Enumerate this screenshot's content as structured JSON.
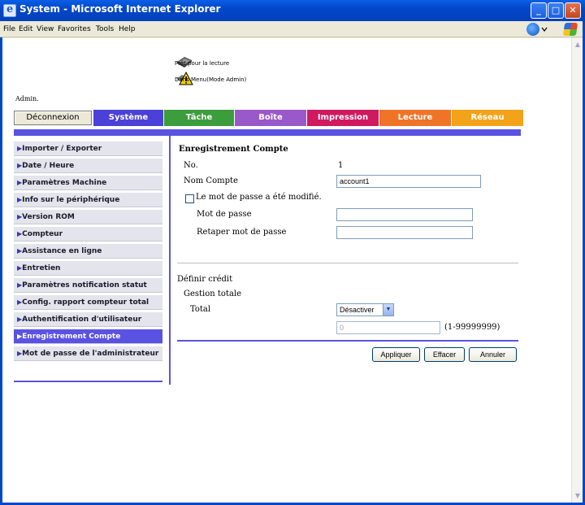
{
  "window": {
    "title": "System - Microsoft Internet Explorer",
    "min": "_",
    "max": "□",
    "close": "✕"
  },
  "menubar": {
    "items": [
      {
        "label": "File",
        "key": "F"
      },
      {
        "label": "Edit",
        "key": "E"
      },
      {
        "label": "View",
        "key": "V"
      },
      {
        "label": "Favorites",
        "key": "a"
      },
      {
        "label": "Tools",
        "key": "T"
      },
      {
        "label": "Help",
        "key": "H"
      }
    ]
  },
  "status": {
    "line1": "Prêt pour la lecture",
    "line2": "Dans Menu(Mode Admin)"
  },
  "admin_label": "Admin.",
  "nav": {
    "logout": "Déconnexion",
    "tabs": [
      "Système",
      "Tâche",
      "Boîte",
      "Impression",
      "Lecture",
      "Réseau"
    ],
    "colors": {
      "Système": "#4b40d7",
      "Tâche": "#3b9d3b",
      "Boîte": "#9a59c9",
      "Impression": "#d0195f",
      "Lecture": "#f07428",
      "Réseau": "#f2a31a"
    }
  },
  "sidebar": {
    "items": [
      "Importer / Exporter",
      "Date / Heure",
      "Paramètres Machine",
      "Info sur le périphérique",
      "Version ROM",
      "Compteur",
      "Assistance en ligne",
      "Entretien",
      "Paramètres notification statut",
      "Config. rapport compteur total",
      "Authentification d'utilisateur",
      "Enregistrement Compte",
      "Mot de passe de l'administrateur"
    ],
    "active_index": 11
  },
  "form": {
    "title": "Enregistrement Compte",
    "no_label": "No.",
    "no_value": "1",
    "name_label": "Nom Compte",
    "name_value": "account1",
    "pw_changed_label": "Le mot de passe a été modifié.",
    "pw_changed_checked": false,
    "password_label": "Mot de passe",
    "password_value": "",
    "retype_label": "Retaper mot de passe",
    "retype_value": "",
    "credit_label": "Définir crédit",
    "total_mgmt_label": "Gestion totale",
    "total_label": "Total",
    "total_select": "Désactiver",
    "total_value": "0",
    "range_label": "(1-99999999)",
    "apply": "Appliquer",
    "clear": "Effacer",
    "cancel": "Annuler"
  },
  "accent_color": "#5a52e2"
}
